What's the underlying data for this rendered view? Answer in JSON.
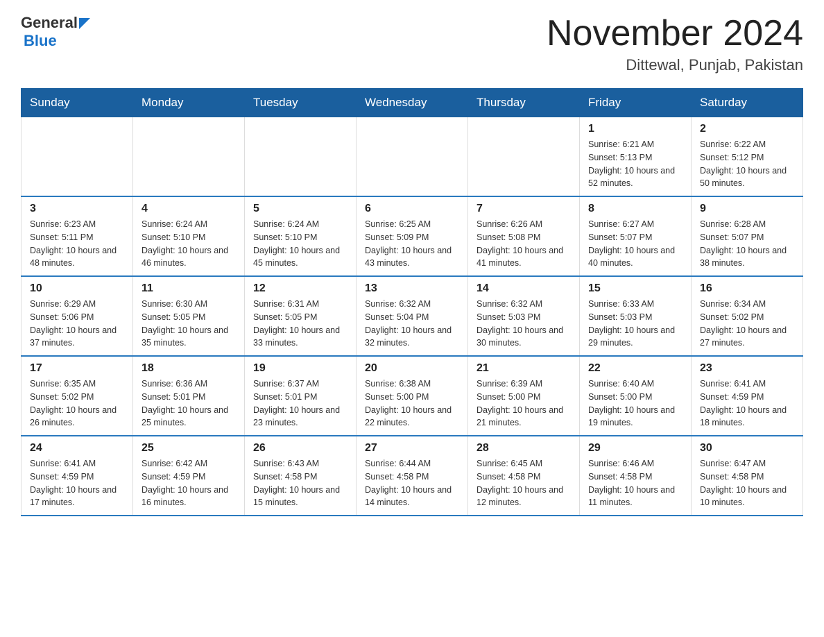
{
  "header": {
    "logo": {
      "line1": "General",
      "arrow": "▶",
      "line2": "Blue"
    },
    "title": "November 2024",
    "location": "Dittewal, Punjab, Pakistan"
  },
  "days_of_week": [
    "Sunday",
    "Monday",
    "Tuesday",
    "Wednesday",
    "Thursday",
    "Friday",
    "Saturday"
  ],
  "weeks": [
    [
      {
        "day": "",
        "info": ""
      },
      {
        "day": "",
        "info": ""
      },
      {
        "day": "",
        "info": ""
      },
      {
        "day": "",
        "info": ""
      },
      {
        "day": "",
        "info": ""
      },
      {
        "day": "1",
        "info": "Sunrise: 6:21 AM\nSunset: 5:13 PM\nDaylight: 10 hours and 52 minutes."
      },
      {
        "day": "2",
        "info": "Sunrise: 6:22 AM\nSunset: 5:12 PM\nDaylight: 10 hours and 50 minutes."
      }
    ],
    [
      {
        "day": "3",
        "info": "Sunrise: 6:23 AM\nSunset: 5:11 PM\nDaylight: 10 hours and 48 minutes."
      },
      {
        "day": "4",
        "info": "Sunrise: 6:24 AM\nSunset: 5:10 PM\nDaylight: 10 hours and 46 minutes."
      },
      {
        "day": "5",
        "info": "Sunrise: 6:24 AM\nSunset: 5:10 PM\nDaylight: 10 hours and 45 minutes."
      },
      {
        "day": "6",
        "info": "Sunrise: 6:25 AM\nSunset: 5:09 PM\nDaylight: 10 hours and 43 minutes."
      },
      {
        "day": "7",
        "info": "Sunrise: 6:26 AM\nSunset: 5:08 PM\nDaylight: 10 hours and 41 minutes."
      },
      {
        "day": "8",
        "info": "Sunrise: 6:27 AM\nSunset: 5:07 PM\nDaylight: 10 hours and 40 minutes."
      },
      {
        "day": "9",
        "info": "Sunrise: 6:28 AM\nSunset: 5:07 PM\nDaylight: 10 hours and 38 minutes."
      }
    ],
    [
      {
        "day": "10",
        "info": "Sunrise: 6:29 AM\nSunset: 5:06 PM\nDaylight: 10 hours and 37 minutes."
      },
      {
        "day": "11",
        "info": "Sunrise: 6:30 AM\nSunset: 5:05 PM\nDaylight: 10 hours and 35 minutes."
      },
      {
        "day": "12",
        "info": "Sunrise: 6:31 AM\nSunset: 5:05 PM\nDaylight: 10 hours and 33 minutes."
      },
      {
        "day": "13",
        "info": "Sunrise: 6:32 AM\nSunset: 5:04 PM\nDaylight: 10 hours and 32 minutes."
      },
      {
        "day": "14",
        "info": "Sunrise: 6:32 AM\nSunset: 5:03 PM\nDaylight: 10 hours and 30 minutes."
      },
      {
        "day": "15",
        "info": "Sunrise: 6:33 AM\nSunset: 5:03 PM\nDaylight: 10 hours and 29 minutes."
      },
      {
        "day": "16",
        "info": "Sunrise: 6:34 AM\nSunset: 5:02 PM\nDaylight: 10 hours and 27 minutes."
      }
    ],
    [
      {
        "day": "17",
        "info": "Sunrise: 6:35 AM\nSunset: 5:02 PM\nDaylight: 10 hours and 26 minutes."
      },
      {
        "day": "18",
        "info": "Sunrise: 6:36 AM\nSunset: 5:01 PM\nDaylight: 10 hours and 25 minutes."
      },
      {
        "day": "19",
        "info": "Sunrise: 6:37 AM\nSunset: 5:01 PM\nDaylight: 10 hours and 23 minutes."
      },
      {
        "day": "20",
        "info": "Sunrise: 6:38 AM\nSunset: 5:00 PM\nDaylight: 10 hours and 22 minutes."
      },
      {
        "day": "21",
        "info": "Sunrise: 6:39 AM\nSunset: 5:00 PM\nDaylight: 10 hours and 21 minutes."
      },
      {
        "day": "22",
        "info": "Sunrise: 6:40 AM\nSunset: 5:00 PM\nDaylight: 10 hours and 19 minutes."
      },
      {
        "day": "23",
        "info": "Sunrise: 6:41 AM\nSunset: 4:59 PM\nDaylight: 10 hours and 18 minutes."
      }
    ],
    [
      {
        "day": "24",
        "info": "Sunrise: 6:41 AM\nSunset: 4:59 PM\nDaylight: 10 hours and 17 minutes."
      },
      {
        "day": "25",
        "info": "Sunrise: 6:42 AM\nSunset: 4:59 PM\nDaylight: 10 hours and 16 minutes."
      },
      {
        "day": "26",
        "info": "Sunrise: 6:43 AM\nSunset: 4:58 PM\nDaylight: 10 hours and 15 minutes."
      },
      {
        "day": "27",
        "info": "Sunrise: 6:44 AM\nSunset: 4:58 PM\nDaylight: 10 hours and 14 minutes."
      },
      {
        "day": "28",
        "info": "Sunrise: 6:45 AM\nSunset: 4:58 PM\nDaylight: 10 hours and 12 minutes."
      },
      {
        "day": "29",
        "info": "Sunrise: 6:46 AM\nSunset: 4:58 PM\nDaylight: 10 hours and 11 minutes."
      },
      {
        "day": "30",
        "info": "Sunrise: 6:47 AM\nSunset: 4:58 PM\nDaylight: 10 hours and 10 minutes."
      }
    ]
  ]
}
